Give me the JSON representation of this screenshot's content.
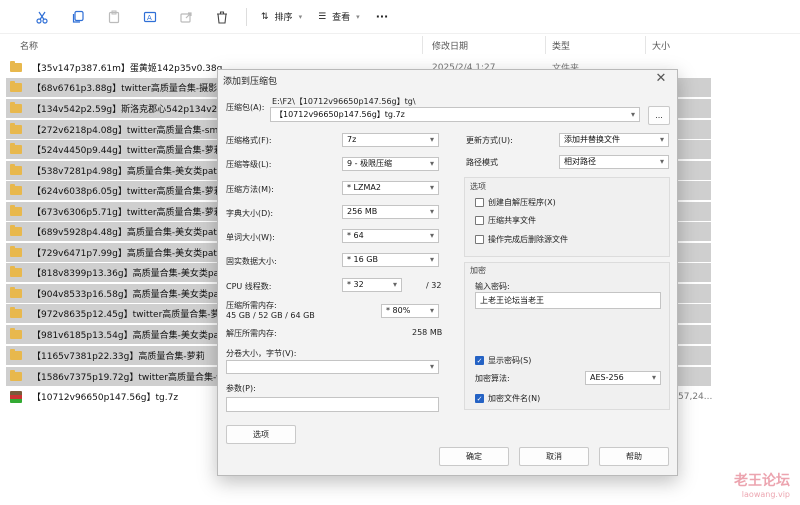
{
  "toolbar": {
    "sort_label": "排序",
    "view_label": "查看",
    "more_label": "···"
  },
  "columns": {
    "name": "名称",
    "date": "修改日期",
    "type": "类型",
    "size": "大小"
  },
  "files": [
    {
      "name": "【35v147p387.61m】蛋黄姬142p35v0.38g",
      "date": "2025/2/4 1:27",
      "type": "文件夹"
    },
    {
      "name": "【68v6761p3.88g】twitter高质量合集-摄影类[6"
    },
    {
      "name": "【134v542p2.59g】斯洛克郡心542p134v2.58g"
    },
    {
      "name": "【272v6218p4.08g】twitter高质量合集-sm类[6"
    },
    {
      "name": "【524v4450p9.44g】twitter高质量合集-萝莉类p"
    },
    {
      "name": "【538v7281p4.98g】高质量合集-美女类patr02("
    },
    {
      "name": "【624v6038p6.05g】twitter高质量合集-萝莉类-"
    },
    {
      "name": "【673v6306p5.71g】twitter高质量合集-萝莉类-"
    },
    {
      "name": "【689v5928p4.48g】高质量合集-美女类patr03("
    },
    {
      "name": "【729v6471p7.99g】高质量合集-美女类patr04("
    },
    {
      "name": "【818v8399p13.36g】高质量合集-美女类patr05"
    },
    {
      "name": "【904v8533p16.58g】高质量合集-美女类patr06"
    },
    {
      "name": "【972v8635p12.45g】twitter高质量合集-萝莉类"
    },
    {
      "name": "【981v6185p13.54g】高质量合集-美女类part01"
    },
    {
      "name": "【1165v7381p22.33g】高质量合集-萝莉"
    },
    {
      "name": "【1586v7375p19.72g】twitter高质量合集-伪娘"
    },
    {
      "name": "【10712v96650p147.56g】tg.7z",
      "size": "57,24..."
    }
  ],
  "dialog": {
    "title": "添加到压缩包",
    "archive_label": "压缩包(A):",
    "archive_path": "E:\\F2\\【10712v96650p147.56g】tg\\",
    "archive_name": "【10712v96650p147.56g】tg.7z",
    "browse_label": "...",
    "format_label": "压缩格式(F):",
    "format_value": "7z",
    "level_label": "压缩等级(L):",
    "level_value": "9 - 极限压缩",
    "method_label": "压缩方法(M):",
    "method_value": "* LZMA2",
    "dict_label": "字典大小(D):",
    "dict_value": "256 MB",
    "word_label": "单词大小(W):",
    "word_value": "* 64",
    "solid_label": "固实数据大小:",
    "solid_value": "* 16 GB",
    "threads_label": "CPU 线程数:",
    "threads_value": "* 32",
    "threads_max": "/ 32",
    "mem_comp_label": "压缩所需内存:",
    "mem_comp_value": "45 GB / 52 GB / 64 GB",
    "mem_pct_value": "* 80%",
    "mem_decomp_label": "解压所需内存:",
    "mem_decomp_value": "258 MB",
    "split_label": "分卷大小，字节(V):",
    "split_value": "",
    "params_label": "参数(P):",
    "params_value": "",
    "options_btn": "选项",
    "update_label": "更新方式(U):",
    "update_value": "添加并替换文件",
    "pathmode_label": "路径模式",
    "pathmode_value": "相对路径",
    "options_group": "选项",
    "opt_sfx": "创建自解压程序(X)",
    "opt_shared": "压缩共享文件",
    "opt_delete": "操作完成后删除源文件",
    "encrypt_group": "加密",
    "pwd_label": "输入密码:",
    "pwd_value": "上老王论坛当老王",
    "show_pwd": "显示密码(S)",
    "enc_method_label": "加密算法:",
    "enc_method_value": "AES-256",
    "enc_names": "加密文件名(N)",
    "ok_label": "确定",
    "cancel_label": "取消",
    "help_label": "帮助"
  },
  "watermark": {
    "title": "老王论坛",
    "sub": "laowang.vip"
  }
}
